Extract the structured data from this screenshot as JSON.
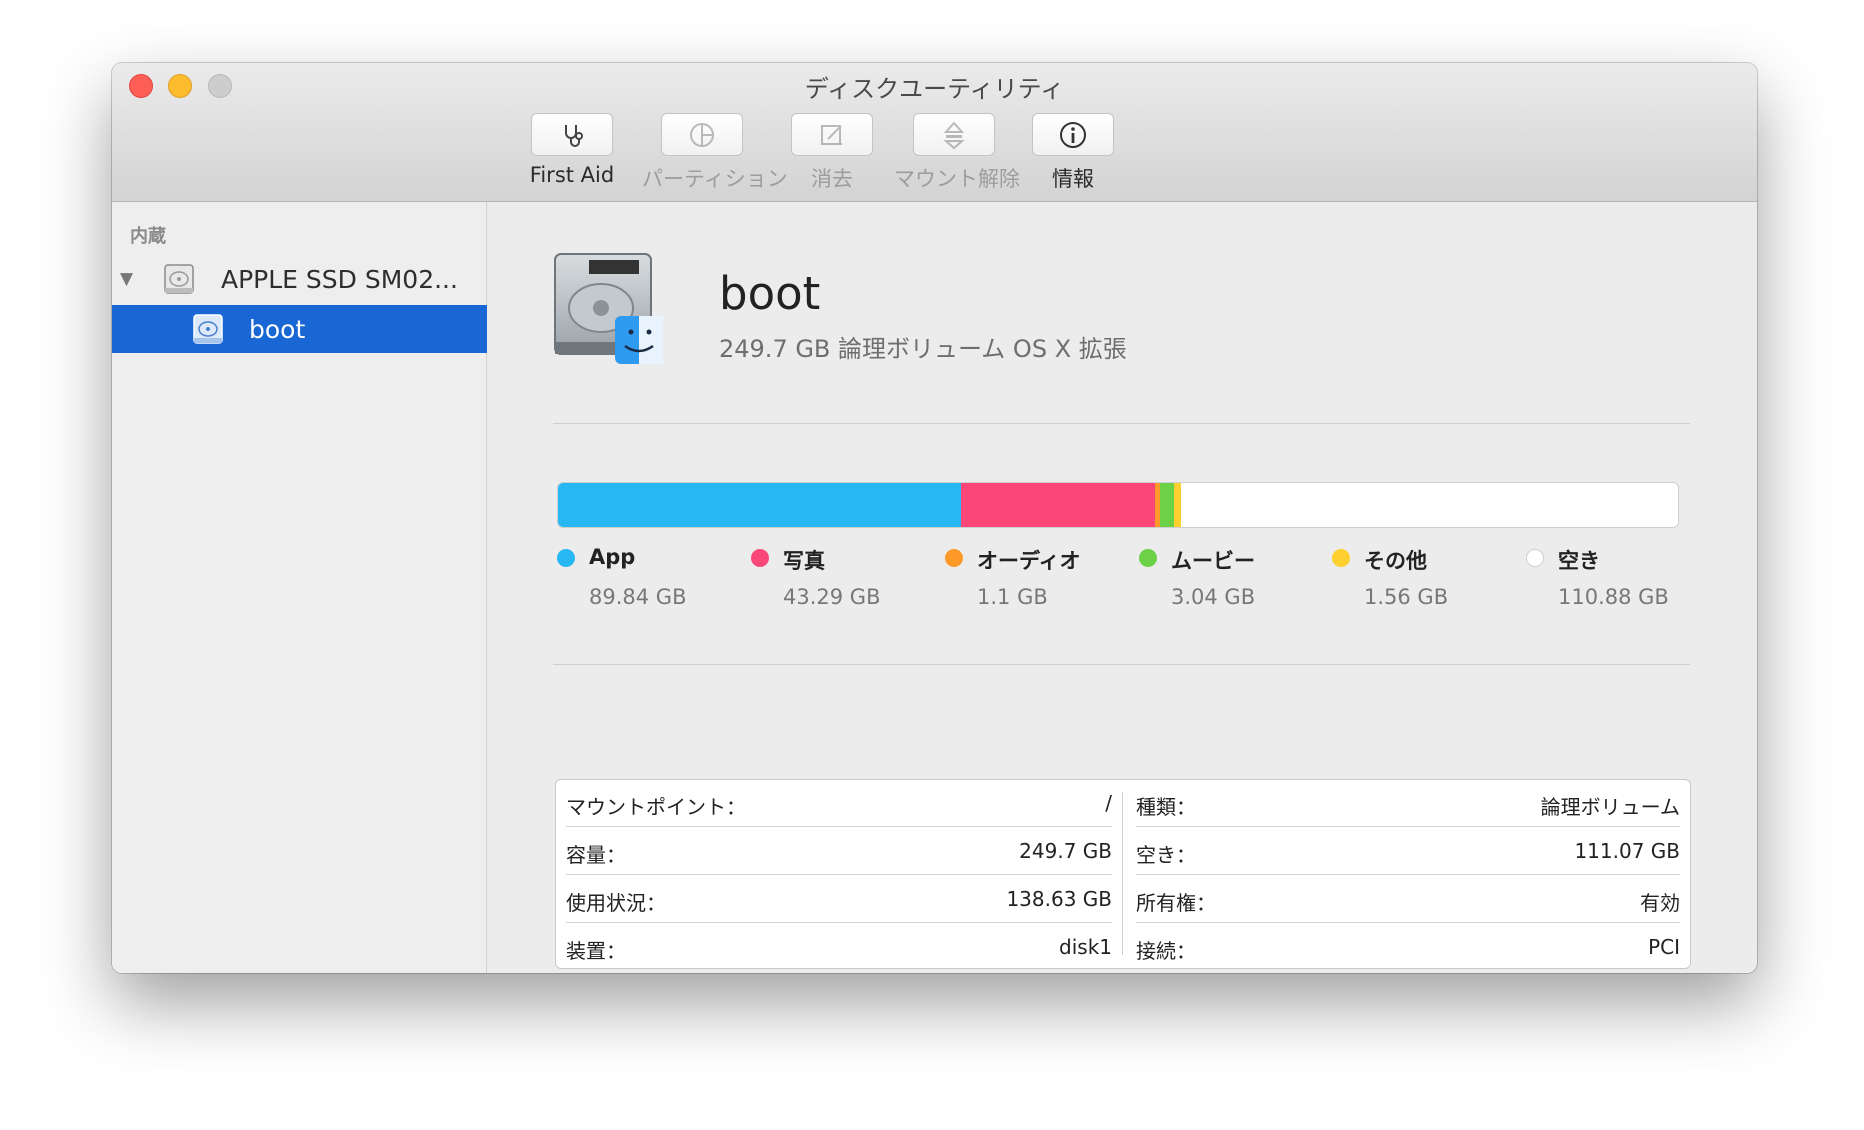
{
  "window": {
    "title": "ディスクユーティリティ"
  },
  "toolbar": [
    {
      "label": "First Aid",
      "icon": "stethoscope-icon",
      "enabled": true
    },
    {
      "label": "パーティション",
      "icon": "partition-pie-icon",
      "enabled": false
    },
    {
      "label": "消去",
      "icon": "erase-icon",
      "enabled": false
    },
    {
      "label": "マウント解除",
      "icon": "eject-icon",
      "enabled": false
    },
    {
      "label": "情報",
      "icon": "info-icon",
      "enabled": true
    }
  ],
  "sidebar": {
    "header": "内蔵",
    "disk": {
      "label": "APPLE SSD SM02..."
    },
    "volume": {
      "label": "boot",
      "selected": true
    }
  },
  "volume": {
    "name": "boot",
    "description": "249.7 GB 論理ボリューム OS X 拡張"
  },
  "usage": [
    {
      "name": "App",
      "size": "89.84 GB",
      "value_gb": 89.84,
      "color": "#27b8f4"
    },
    {
      "name": "写真",
      "size": "43.29 GB",
      "value_gb": 43.29,
      "color": "#fb4777"
    },
    {
      "name": "オーディオ",
      "size": "1.1 GB",
      "value_gb": 1.1,
      "color": "#fd9a2a"
    },
    {
      "name": "ムービー",
      "size": "3.04 GB",
      "value_gb": 3.04,
      "color": "#6cd146"
    },
    {
      "name": "その他",
      "size": "1.56 GB",
      "value_gb": 1.56,
      "color": "#fed02f"
    },
    {
      "name": "空き",
      "size": "110.88 GB",
      "value_gb": 110.88,
      "color": "#ffffff"
    }
  ],
  "info": {
    "left": [
      {
        "label": "マウントポイント：",
        "value": "/"
      },
      {
        "label": "容量：",
        "value": "249.7 GB"
      },
      {
        "label": "使用状況：",
        "value": "138.63 GB"
      },
      {
        "label": "装置：",
        "value": "disk1"
      }
    ],
    "right": [
      {
        "label": "種類：",
        "value": "論理ボリューム"
      },
      {
        "label": "空き：",
        "value": "111.07 GB"
      },
      {
        "label": "所有権：",
        "value": "有効"
      },
      {
        "label": "接続：",
        "value": "PCI"
      }
    ]
  }
}
